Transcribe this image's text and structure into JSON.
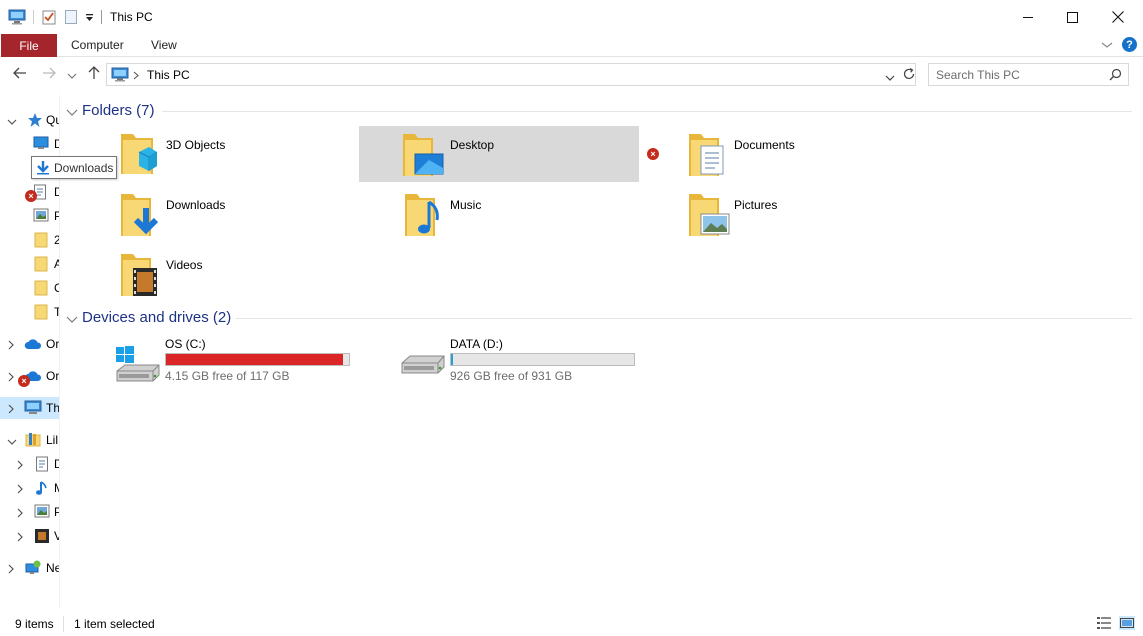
{
  "window": {
    "title": "This PC",
    "minimize_glyph": "—",
    "maximize_glyph": "☐",
    "close_glyph": "✕"
  },
  "ribbon": {
    "tabs": [
      "File",
      "Computer",
      "View"
    ],
    "help_glyph": "?"
  },
  "navbar": {
    "address": "This PC",
    "search_placeholder": "Search This PC"
  },
  "nav_pane": {
    "items": [
      {
        "label": "Qu",
        "icon": "star-icon",
        "expanded": true
      },
      {
        "label": "D",
        "icon": "desktop-icon"
      },
      {
        "label": "D",
        "icon": "document-icon",
        "sync_error": true
      },
      {
        "label": "P",
        "icon": "pictures-icon"
      },
      {
        "label": "2",
        "icon": "folder-icon"
      },
      {
        "label": "A",
        "icon": "folder-icon"
      },
      {
        "label": "C",
        "icon": "folder-icon"
      },
      {
        "label": "T",
        "icon": "folder-icon"
      },
      {
        "label": "Or",
        "icon": "onedrive-icon"
      },
      {
        "label": "Or",
        "icon": "onedrive-icon",
        "sync_error": true
      },
      {
        "label": "Th",
        "icon": "this-pc-icon",
        "selected": true
      },
      {
        "label": "Lil",
        "icon": "libraries-icon",
        "expanded": true
      },
      {
        "label": "D",
        "icon": "document-icon"
      },
      {
        "label": "M",
        "icon": "music-icon"
      },
      {
        "label": "P",
        "icon": "pictures-icon"
      },
      {
        "label": "V",
        "icon": "videos-icon"
      },
      {
        "label": "Ne",
        "icon": "network-icon"
      }
    ],
    "tooltip": "Downloads"
  },
  "folders": {
    "header": "Folders (7)",
    "items": [
      {
        "label": "3D Objects",
        "icon": "3d-objects-icon"
      },
      {
        "label": "Desktop",
        "icon": "desktop-folder-icon",
        "selected": true,
        "sync_error": true
      },
      {
        "label": "Documents",
        "icon": "documents-folder-icon"
      },
      {
        "label": "Downloads",
        "icon": "downloads-folder-icon"
      },
      {
        "label": "Music",
        "icon": "music-folder-icon"
      },
      {
        "label": "Pictures",
        "icon": "pictures-folder-icon"
      },
      {
        "label": "Videos",
        "icon": "videos-folder-icon"
      }
    ]
  },
  "drives": {
    "header": "Devices and drives (2)",
    "items": [
      {
        "name": "OS (C:)",
        "free_text": "4.15 GB free of 117 GB",
        "used_fraction": 0.965,
        "bar_color": "#da2626",
        "windows_logo": true
      },
      {
        "name": "DATA (D:)",
        "free_text": "926 GB free of 931 GB",
        "used_fraction": 0.005,
        "bar_color": "#26a0da",
        "windows_logo": false
      }
    ]
  },
  "status": {
    "items": "9 items",
    "selected": "1 item selected"
  },
  "colors": {
    "accent_file_tab": "#a4262c",
    "group_header": "#1e3287",
    "selection": "#d9d9d9"
  }
}
